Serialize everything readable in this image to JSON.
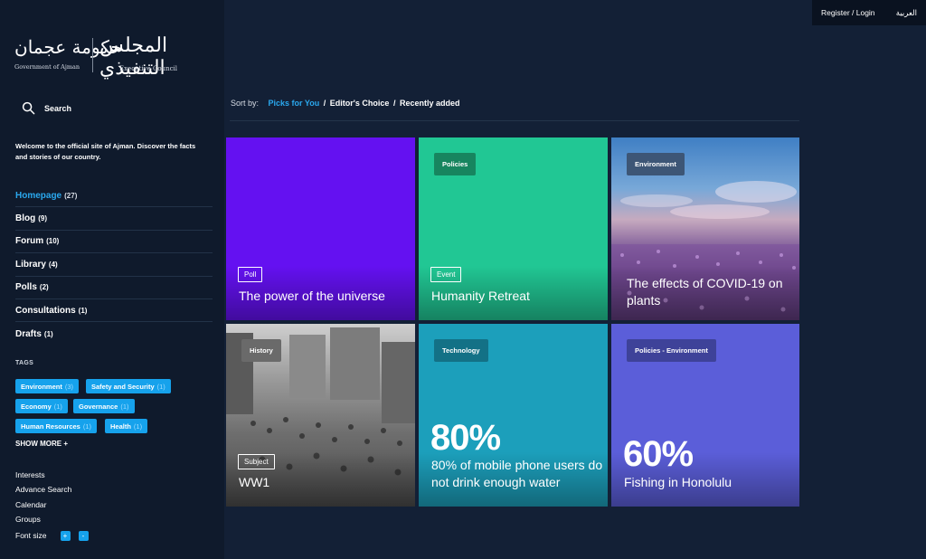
{
  "logo": {
    "arabic_gov": "حكومة عجمان",
    "gov_label": "Government of Ajman",
    "arabic_council": "المجلس التنفيذي",
    "council_label": "Executive Council"
  },
  "topbar": {
    "login": "Register / Login",
    "language": "العربية"
  },
  "search": {
    "label": "Search"
  },
  "welcome": "Welcome to the official site of Ajman. Discover the facts and stories of our country.",
  "nav": [
    {
      "label": "Homepage",
      "count": "(27)"
    },
    {
      "label": "Blog",
      "count": "(9)"
    },
    {
      "label": "Forum",
      "count": "(10)"
    },
    {
      "label": "Library",
      "count": "(4)"
    },
    {
      "label": "Polls",
      "count": "(2)"
    },
    {
      "label": "Consultations",
      "count": "(1)"
    },
    {
      "label": "Drafts",
      "count": "(1)"
    }
  ],
  "tags_title": "TAGS",
  "tags": [
    {
      "label": "Environment",
      "count": "(3)"
    },
    {
      "label": "Safety and Security",
      "count": "(1)"
    },
    {
      "label": "Economy",
      "count": "(1)"
    },
    {
      "label": "Governance",
      "count": "(1)"
    },
    {
      "label": "Human Resources",
      "count": "(1)"
    },
    {
      "label": "Health",
      "count": "(1)"
    }
  ],
  "show_more": "SHOW MORE +",
  "links": {
    "interests": "Interests",
    "advance_search": "Advance Search",
    "calendar": "Calendar",
    "groups": "Groups",
    "font_size": "Font size",
    "plus": "+",
    "minus": "-"
  },
  "sort": {
    "label": "Sort by:",
    "options": [
      "Picks for You",
      "Editor's Choice",
      "Recently added"
    ],
    "separator": "/"
  },
  "cards": [
    {
      "type": "Poll",
      "title": "The power of the universe"
    },
    {
      "category": "Policies",
      "type": "Event",
      "title": "Humanity Retreat"
    },
    {
      "category": "Environment",
      "title": "The effects of COVID-19 on plants"
    },
    {
      "category": "History",
      "type": "Subject",
      "title": "WW1"
    },
    {
      "category": "Technology",
      "stat": "80%",
      "title": "80% of mobile phone users do not drink enough water"
    },
    {
      "category": "Policies - Environment",
      "stat": "60%",
      "title": "Fishing in Honolulu"
    }
  ],
  "colors": {
    "accent": "#2aa8ee",
    "card_purple": "#6411f1",
    "card_green": "#21c794",
    "card_teal": "#1c9fbb",
    "card_indigo": "#5b5ed9"
  }
}
